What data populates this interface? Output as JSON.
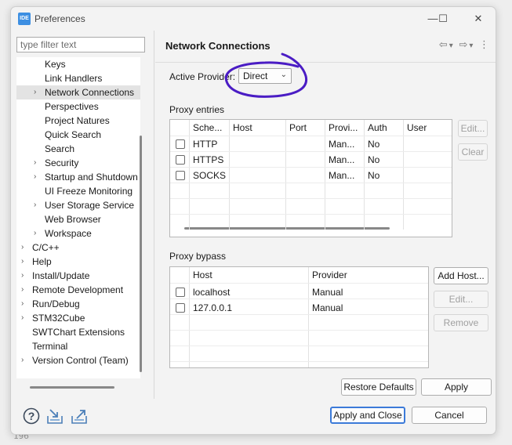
{
  "background": {
    "line_number": "196"
  },
  "window": {
    "app_icon_label": "IDE",
    "title": "Preferences",
    "controls": {
      "minimize": "—",
      "maximize": "☐",
      "close": "✕"
    }
  },
  "left": {
    "filter_placeholder": "type filter text",
    "tree": [
      {
        "label": "Keys",
        "chevron": ""
      },
      {
        "label": "Link Handlers",
        "chevron": ""
      },
      {
        "label": "Network Connections",
        "chevron": "›",
        "selected": true
      },
      {
        "label": "Perspectives",
        "chevron": ""
      },
      {
        "label": "Project Natures",
        "chevron": ""
      },
      {
        "label": "Quick Search",
        "chevron": ""
      },
      {
        "label": "Search",
        "chevron": ""
      },
      {
        "label": "Security",
        "chevron": "›"
      },
      {
        "label": "Startup and Shutdown",
        "chevron": "›"
      },
      {
        "label": "UI Freeze Monitoring",
        "chevron": ""
      },
      {
        "label": "User Storage Service",
        "chevron": "›"
      },
      {
        "label": "Web Browser",
        "chevron": ""
      },
      {
        "label": "Workspace",
        "chevron": "›"
      },
      {
        "label": "C/C++",
        "chevron": "›"
      },
      {
        "label": "Help",
        "chevron": "›"
      },
      {
        "label": "Install/Update",
        "chevron": "›"
      },
      {
        "label": "Remote Development",
        "chevron": "›"
      },
      {
        "label": "Run/Debug",
        "chevron": "›"
      },
      {
        "label": "STM32Cube",
        "chevron": "›"
      },
      {
        "label": "SWTChart Extensions",
        "chevron": ""
      },
      {
        "label": "Terminal",
        "chevron": ""
      },
      {
        "label": "Version Control (Team)",
        "chevron": "›"
      }
    ]
  },
  "right": {
    "title": "Network Connections",
    "nav": {
      "back": "⇦",
      "back_menu": "▾",
      "forward": "⇨",
      "forward_menu": "▾",
      "more": "⋮"
    },
    "active_provider": {
      "label": "Active Provider:",
      "value": "Direct",
      "caret": "⌄"
    },
    "proxy_entries": {
      "label": "Proxy entries",
      "columns": [
        "Sche...",
        "Host",
        "Port",
        "Provi...",
        "Auth",
        "User"
      ],
      "rows": [
        {
          "scheme": "HTTP",
          "host": "",
          "port": "",
          "provider": "Man...",
          "auth": "No",
          "user": ""
        },
        {
          "scheme": "HTTPS",
          "host": "",
          "port": "",
          "provider": "Man...",
          "auth": "No",
          "user": ""
        },
        {
          "scheme": "SOCKS",
          "host": "",
          "port": "",
          "provider": "Man...",
          "auth": "No",
          "user": ""
        }
      ],
      "buttons": {
        "edit": "Edit...",
        "clear": "Clear"
      }
    },
    "proxy_bypass": {
      "label": "Proxy bypass",
      "columns": [
        "Host",
        "Provider"
      ],
      "rows": [
        {
          "host": "localhost",
          "provider": "Manual"
        },
        {
          "host": "127.0.0.1",
          "provider": "Manual"
        }
      ],
      "buttons": {
        "add_host": "Add Host...",
        "edit": "Edit...",
        "remove": "Remove"
      }
    },
    "restore_defaults": "Restore Defaults",
    "apply": "Apply"
  },
  "bottom": {
    "icons": [
      "help-icon",
      "import-icon",
      "export-icon"
    ],
    "help_glyph": "?",
    "apply_and_close": "Apply and Close",
    "cancel": "Cancel"
  },
  "colors": {
    "accent": "#3b7ad9",
    "annotation": "#4a1cc4",
    "app_icon": "#3d8fe2"
  }
}
